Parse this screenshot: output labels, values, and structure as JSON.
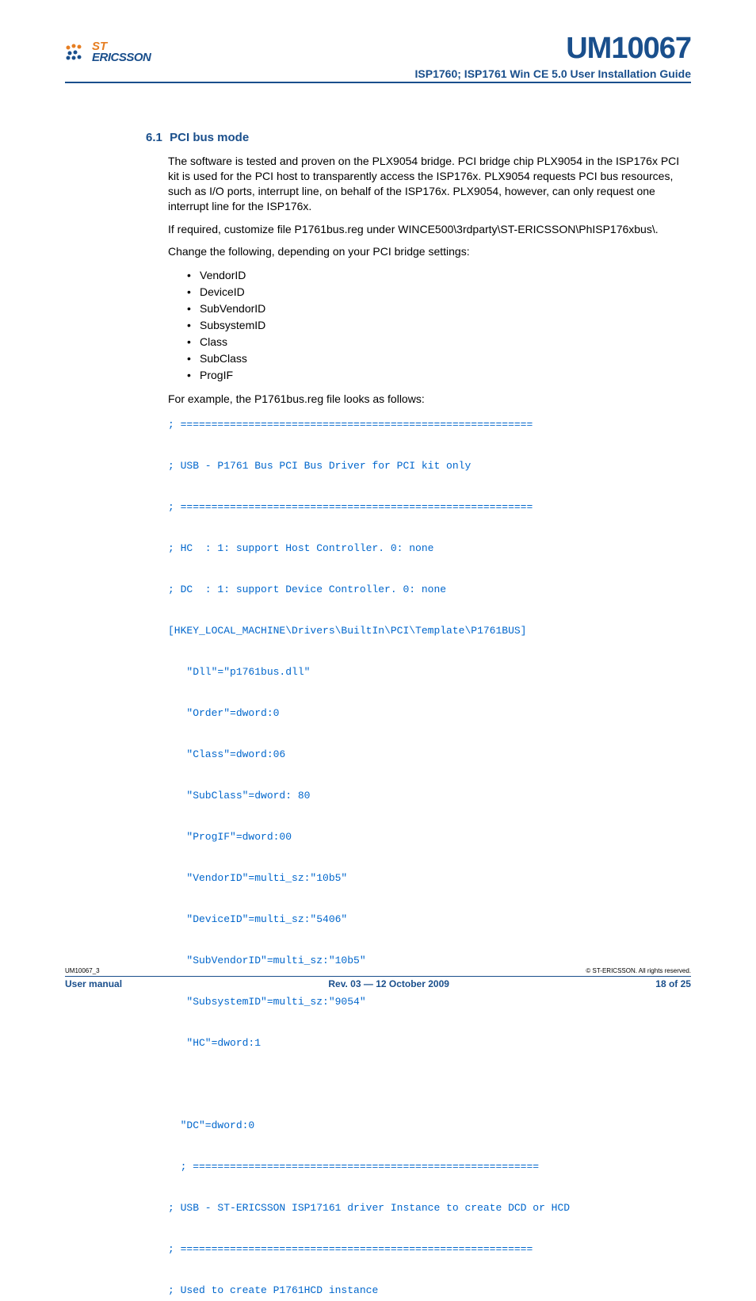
{
  "header": {
    "logo_st": "ST",
    "logo_ericsson": "ERICSSON",
    "doc_id": "UM10067",
    "doc_subtitle": "ISP1760; ISP1761 Win CE 5.0 User Installation Guide"
  },
  "section": {
    "number": "6.1",
    "title": "PCI bus mode",
    "para1": "The software is tested and proven on the PLX9054 bridge. PCI bridge chip PLX9054 in the ISP176x PCI kit is used for the PCI host to transparently access the ISP176x. PLX9054 requests PCI bus resources, such as I/O ports, interrupt line, on behalf of the ISP176x. PLX9054, however, can only request one interrupt line for the ISP176x.",
    "para2": "If required, customize file P1761bus.reg under WINCE500\\3rdparty\\ST-ERICSSON\\PhISP176xbus\\.",
    "para3": "Change the following, depending on your PCI bridge settings:",
    "bullets": [
      "VendorID",
      "DeviceID",
      "SubVendorID",
      "SubsystemID",
      "Class",
      "SubClass",
      "ProgIF"
    ],
    "para4": "For example, the P1761bus.reg file looks as follows:",
    "code": "; =========================================================\n\n; USB - P1761 Bus PCI Bus Driver for PCI kit only\n\n; =========================================================\n\n; HC  : 1: support Host Controller. 0: none\n\n; DC  : 1: support Device Controller. 0: none\n\n[HKEY_LOCAL_MACHINE\\Drivers\\BuiltIn\\PCI\\Template\\P1761BUS]\n\n   \"Dll\"=\"p1761bus.dll\"\n\n   \"Order\"=dword:0\n\n   \"Class\"=dword:06\n\n   \"SubClass\"=dword: 80\n\n   \"ProgIF\"=dword:00\n\n   \"VendorID\"=multi_sz:\"10b5\"\n\n   \"DeviceID\"=multi_sz:\"5406\"\n\n   \"SubVendorID\"=multi_sz:\"10b5\"\n\n   \"SubsystemID\"=multi_sz:\"9054\"\n\n   \"HC\"=dword:1\n\n\n\n  \"DC\"=dword:0\n\n  ; ========================================================\n\n; USB - ST-ERICSSON ISP17161 driver Instance to create DCD or HCD\n\n; =========================================================\n\n; Used to create P1761HCD instance"
  },
  "footer": {
    "left_small": "UM10067_3",
    "right_small": "© ST-ERICSSON. All rights reserved.",
    "left_bold": "User manual",
    "center_bold": "Rev. 03 — 12 October 2009",
    "right_bold": "18 of 25"
  }
}
